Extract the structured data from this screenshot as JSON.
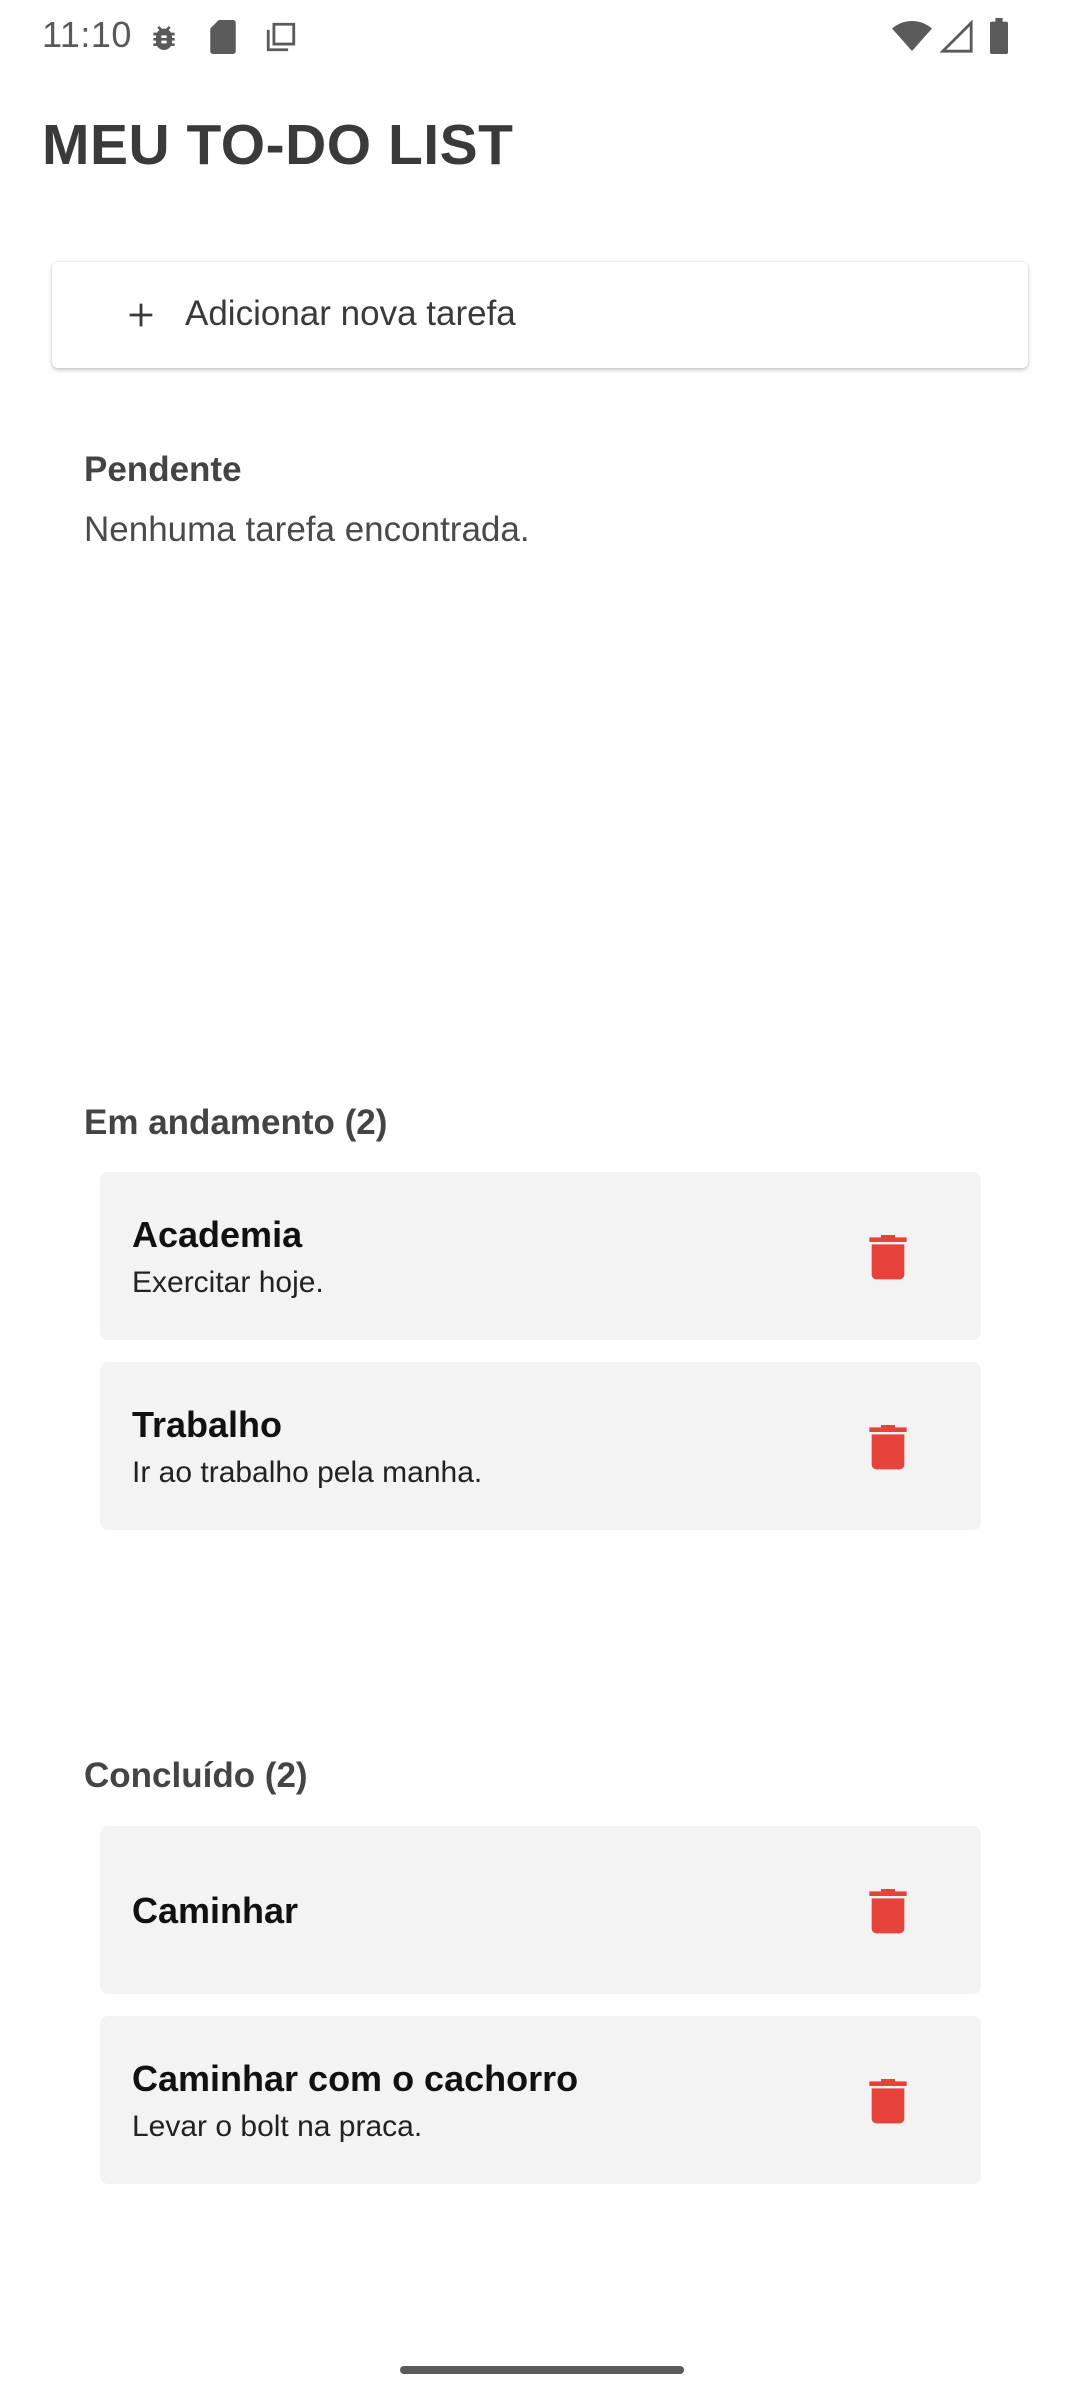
{
  "status_bar": {
    "time": "11:10",
    "left_icons": [
      "bug-icon",
      "sd-card-icon",
      "copy-icon"
    ],
    "right_icons": [
      "wifi-icon",
      "cellular-signal-icon",
      "battery-icon"
    ]
  },
  "header": {
    "title": "MEU TO-DO LIST"
  },
  "add_task": {
    "icon": "plus-icon",
    "label": "Adicionar nova tarefa"
  },
  "sections": {
    "pending": {
      "heading": "Pendente",
      "empty_message": "Nenhuma tarefa encontrada."
    },
    "in_progress": {
      "heading": "Em andamento (2)",
      "tasks": [
        {
          "title": "Academia",
          "description": "Exercitar hoje."
        },
        {
          "title": "Trabalho",
          "description": "Ir ao trabalho pela manha."
        }
      ]
    },
    "done": {
      "heading": "Concluído (2)",
      "tasks": [
        {
          "title": "Caminhar",
          "description": ""
        },
        {
          "title": "Caminhar com o cachorro",
          "description": "Levar o bolt na praca."
        }
      ]
    }
  },
  "colors": {
    "delete_icon": "#e5433a",
    "card_background": "#f3f3f3",
    "title_text": "#3a3a3a"
  }
}
